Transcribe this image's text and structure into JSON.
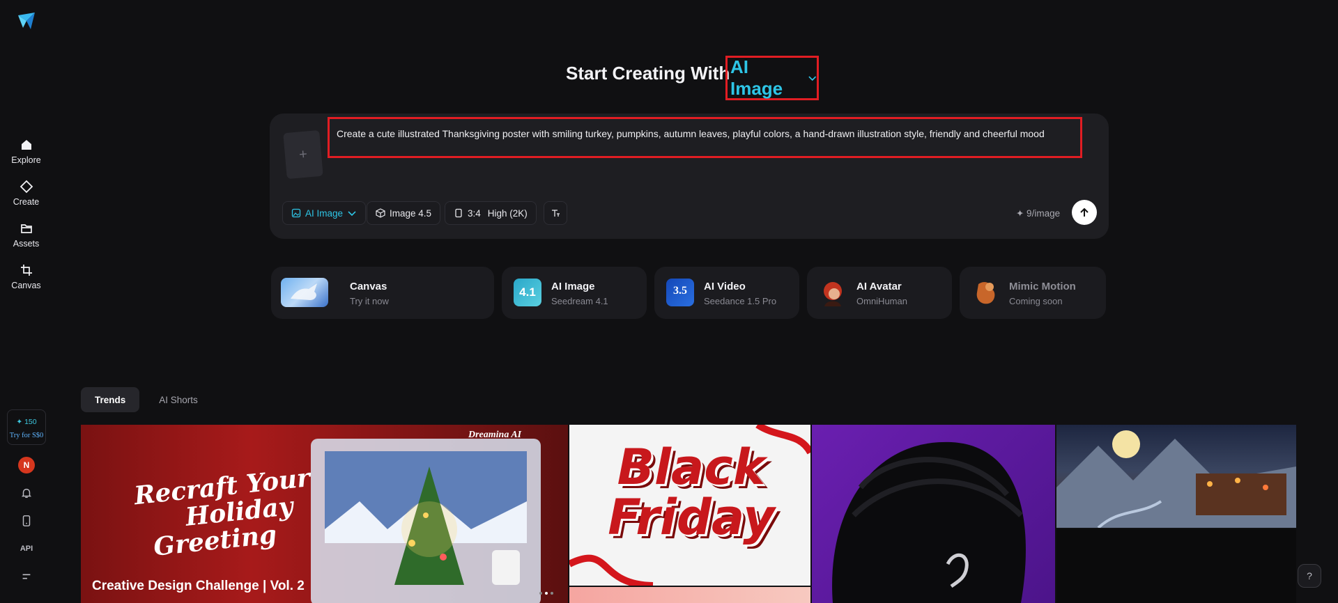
{
  "sidebar": {
    "items": [
      {
        "label": "Explore"
      },
      {
        "label": "Create"
      },
      {
        "label": "Assets"
      },
      {
        "label": "Canvas"
      }
    ],
    "credits": {
      "amount": "✦ 150",
      "cta": "Try for S$0"
    },
    "avatar_initial": "N",
    "api_label": "API"
  },
  "hero": {
    "title": "Start Creating With",
    "mode": "AI Image"
  },
  "composer": {
    "prompt": "Create a cute illustrated Thanksgiving poster with smiling turkey, pumpkins, autumn leaves, playful colors, a hand-drawn illustration style, friendly and cheerful mood",
    "chips": {
      "mode": "AI Image",
      "model": "Image 4.5",
      "ratio": "3:4",
      "quality": "High (2K)"
    },
    "cost": "✦ 9/image"
  },
  "tools": [
    {
      "title": "Canvas",
      "subtitle": "Try it now"
    },
    {
      "title": "AI Image",
      "subtitle": "Seedream 4.1",
      "badge": "4.1"
    },
    {
      "title": "AI Video",
      "subtitle": "Seedance 1.5 Pro",
      "badge": "3.5"
    },
    {
      "title": "AI Avatar",
      "subtitle": "OmniHuman"
    },
    {
      "title": "Mimic Motion",
      "subtitle": "Coming soon"
    }
  ],
  "tabs": [
    {
      "label": "Trends"
    },
    {
      "label": "AI Shorts"
    }
  ],
  "gallery": {
    "banner": {
      "headline_line1": "Recraft Your",
      "headline_line2": "Holiday",
      "headline_line3": "Greeting",
      "brand": "Dreamina AI",
      "caption": "Creative Design Challenge | Vol. 2"
    },
    "black_friday": {
      "line1": "Black",
      "line2": "Friday"
    }
  },
  "colors": {
    "accent": "#2ec5e6",
    "highlight_box": "#e11d23",
    "background": "#101012"
  }
}
